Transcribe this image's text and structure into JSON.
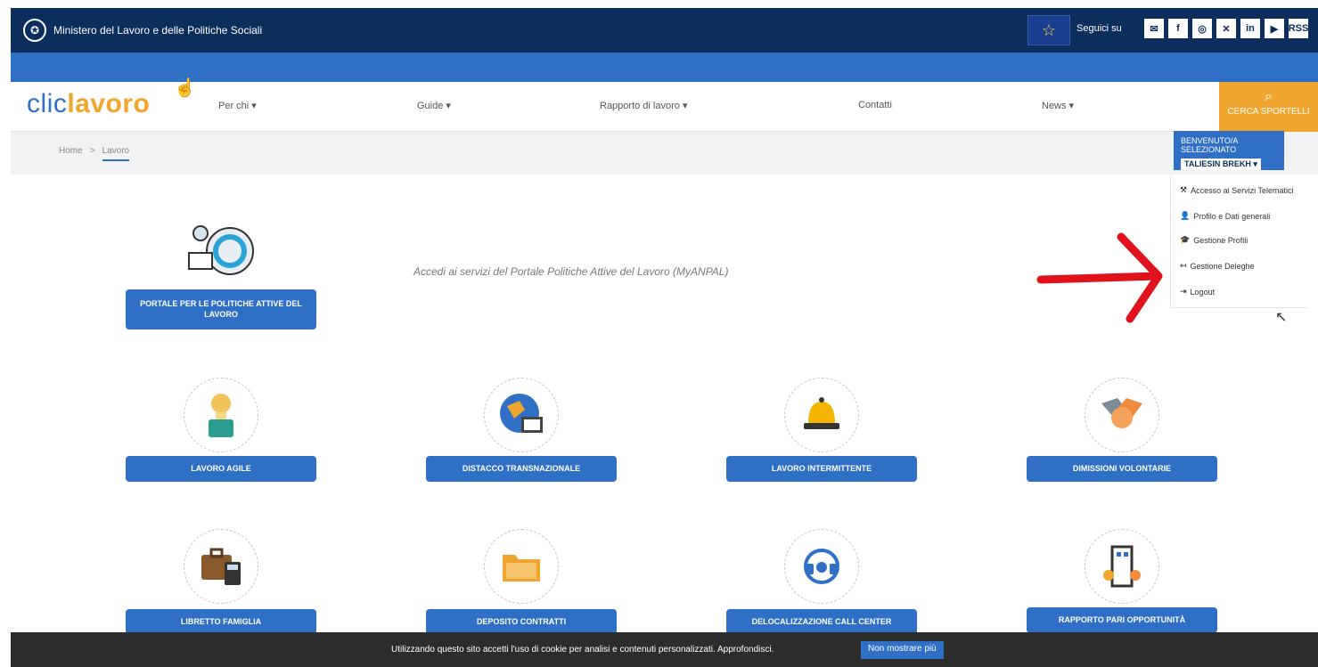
{
  "topbar": {
    "ministry": "Ministero del Lavoro e delle Politiche Sociali",
    "seguici": "Seguici su",
    "socials": [
      "✉",
      "f",
      "◎",
      "✕",
      "in",
      "▶",
      "RSS"
    ]
  },
  "navbar": {
    "logo_a": "clic",
    "logo_b": "lavoro",
    "items": [
      "Per chi ▾",
      "Guide ▾",
      "Rapporto di lavoro ▾",
      "Contatti",
      "News ▾"
    ],
    "search_label": "CERCA SPORTELLI"
  },
  "breadcrumb": {
    "home": "Home",
    "sep": ">",
    "current": "Lavoro"
  },
  "user": {
    "label": "BENVENUTO/A SELEZIONATO",
    "name": "TALIESIN BREKH ▾"
  },
  "dropdown": {
    "items": [
      {
        "icon": "⚒",
        "label": "Accesso ai Servizi Telematici"
      },
      {
        "icon": "👤",
        "label": "Profilo e Dati generali"
      },
      {
        "icon": "🎓",
        "label": "Gestione Profili"
      },
      {
        "icon": "↤",
        "label": "Gestione Deleghe"
      },
      {
        "icon": "⇥",
        "label": "Logout"
      }
    ]
  },
  "hero": {
    "button": "PORTALE PER LE POLITICHE ATTIVE DEL LAVORO",
    "text": "Accedi ai servizi del Portale Politiche Attive del Lavoro (MyANPAL)"
  },
  "tiles": [
    {
      "label": "LAVORO AGILE"
    },
    {
      "label": "DISTACCO TRANSNAZIONALE"
    },
    {
      "label": "LAVORO INTERMITTENTE"
    },
    {
      "label": "DIMISSIONI VOLONTARIE"
    },
    {
      "label": "LIBRETTO FAMIGLIA"
    },
    {
      "label": "DEPOSITO CONTRATTI"
    },
    {
      "label": "DELOCALIZZAZIONE CALL CENTER"
    },
    {
      "label": "RAPPORTO PARI OPPORTUNITÀ"
    }
  ],
  "cookie": {
    "text": "Utilizzando questo sito accetti l'uso di cookie per analisi e contenuti personalizzati.  Approfondisci.",
    "button": "Non mostrare più"
  },
  "colors": {
    "navy": "#0b2e5c",
    "blue": "#2f6fc6",
    "orange": "#f0a52e",
    "red": "#e0121b"
  }
}
